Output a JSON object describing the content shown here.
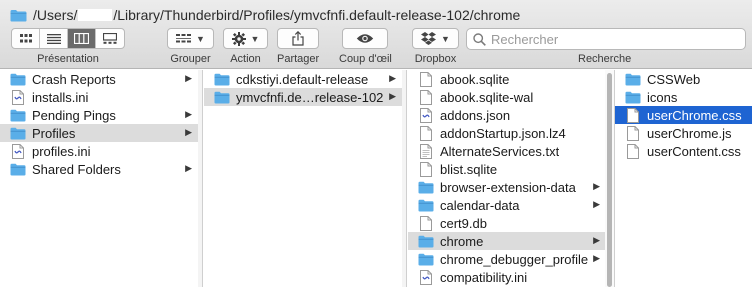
{
  "window": {
    "path_prefix": "/Users/",
    "path_suffix": "/Library/Thunderbird/Profiles/ymvcfnfi.default-release-102/chrome"
  },
  "toolbar": {
    "presentation_label": "Présentation",
    "grouper_label": "Grouper",
    "action_label": "Action",
    "partager_label": "Partager",
    "coup_label": "Coup d'œil",
    "dropbox_label": "Dropbox",
    "recherche_label": "Recherche",
    "search_placeholder": "Rechercher",
    "active_view": "columns"
  },
  "columns": [
    {
      "items": [
        {
          "label": "Crash Reports",
          "icon": "folder-icon",
          "has_children": true
        },
        {
          "label": "installs.ini",
          "icon": "ini-file-icon",
          "has_children": false
        },
        {
          "label": "Pending Pings",
          "icon": "folder-icon",
          "has_children": true
        },
        {
          "label": "Profiles",
          "icon": "folder-icon",
          "has_children": true,
          "selected": "gray"
        },
        {
          "label": "profiles.ini",
          "icon": "ini-file-icon",
          "has_children": false
        },
        {
          "label": "Shared Folders",
          "icon": "folder-icon",
          "has_children": true
        }
      ]
    },
    {
      "items": [
        {
          "label": "cdkstiyi.default-release",
          "icon": "folder-icon",
          "has_children": true
        },
        {
          "label": "ymvcfnfi.de…release-102",
          "icon": "folder-icon",
          "has_children": true,
          "selected": "gray"
        }
      ]
    },
    {
      "items": [
        {
          "label": "abook.sqlite",
          "icon": "file-icon",
          "has_children": false
        },
        {
          "label": "abook.sqlite-wal",
          "icon": "file-icon",
          "has_children": false
        },
        {
          "label": "addons.json",
          "icon": "json-file-icon",
          "has_children": false
        },
        {
          "label": "addonStartup.json.lz4",
          "icon": "file-icon",
          "has_children": false
        },
        {
          "label": "AlternateServices.txt",
          "icon": "text-file-icon",
          "has_children": false
        },
        {
          "label": "blist.sqlite",
          "icon": "file-icon",
          "has_children": false
        },
        {
          "label": "browser-extension-data",
          "icon": "folder-icon",
          "has_children": true
        },
        {
          "label": "calendar-data",
          "icon": "folder-icon",
          "has_children": true
        },
        {
          "label": "cert9.db",
          "icon": "file-icon",
          "has_children": false
        },
        {
          "label": "chrome",
          "icon": "folder-icon",
          "has_children": true,
          "selected": "gray"
        },
        {
          "label": "chrome_debugger_profile",
          "icon": "folder-icon",
          "has_children": true
        },
        {
          "label": "compatibility.ini",
          "icon": "ini-file-icon",
          "has_children": false
        }
      ]
    },
    {
      "items": [
        {
          "label": "CSSWeb",
          "icon": "folder-icon",
          "has_children": false
        },
        {
          "label": "icons",
          "icon": "folder-icon",
          "has_children": false
        },
        {
          "label": "userChrome.css",
          "icon": "file-icon",
          "has_children": false,
          "selected": "blue"
        },
        {
          "label": "userChrome.js",
          "icon": "file-icon",
          "has_children": false
        },
        {
          "label": "userContent.css",
          "icon": "file-icon",
          "has_children": false
        }
      ]
    }
  ],
  "colors": {
    "folder": "#5aaee8",
    "selection_blue": "#1e64d2",
    "selection_gray": "#dcdcdc"
  }
}
